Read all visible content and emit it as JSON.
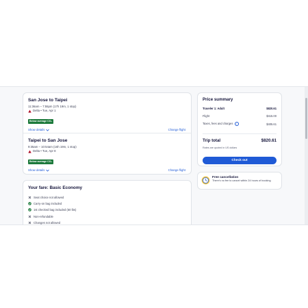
{
  "flights": [
    {
      "route": "San Jose to Taipei",
      "times": "11:36am – 7:55pm (17h 19m, 1 stop)",
      "airline": "Delta • Tue, Apr 1",
      "badge": "Below average CO₂",
      "show_details": "Show details",
      "change_flight": "Change flight"
    },
    {
      "route": "Taipei to San Jose",
      "times": "9:35am – 10:54am (16h 19m, 1 stop)",
      "airline": "Delta • Tue, Apr 8",
      "badge": "Below average CO₂",
      "show_details": "Show details",
      "change_flight": "Change flight"
    }
  ],
  "fare": {
    "title": "Your fare: Basic Economy",
    "items": [
      {
        "text": "Seat choice not allowed",
        "icon": "x-icon"
      },
      {
        "text": "Carry-on bag included",
        "icon": "check-icon"
      },
      {
        "text": "1st checked bag included (50 lbs)",
        "icon": "check-icon"
      },
      {
        "text": "Non-refundable",
        "icon": "x-icon"
      },
      {
        "text": "Changes not allowed",
        "icon": "x-icon"
      }
    ]
  },
  "summary": {
    "title": "Price summary",
    "traveler_label": "Traveler 1: Adult",
    "traveler_value": "$820.61",
    "flight_label": "Flight",
    "flight_value": "$415.00",
    "taxes_label": "Taxes, fees and charges",
    "taxes_value": "$405.61",
    "total_label": "Trip total",
    "total_value": "$820.61",
    "rates_note": "Rates are quoted in US dollars",
    "checkout_label": "Check out"
  },
  "cancellation": {
    "title": "Free cancellation",
    "description": "There's no fee to cancel within 24 hours of booking"
  },
  "colors": {
    "accent": "#1f5ad6",
    "eco_green": "#1d7a3c",
    "delta_red": "#c8102e",
    "check_green": "#1d7a3c"
  }
}
